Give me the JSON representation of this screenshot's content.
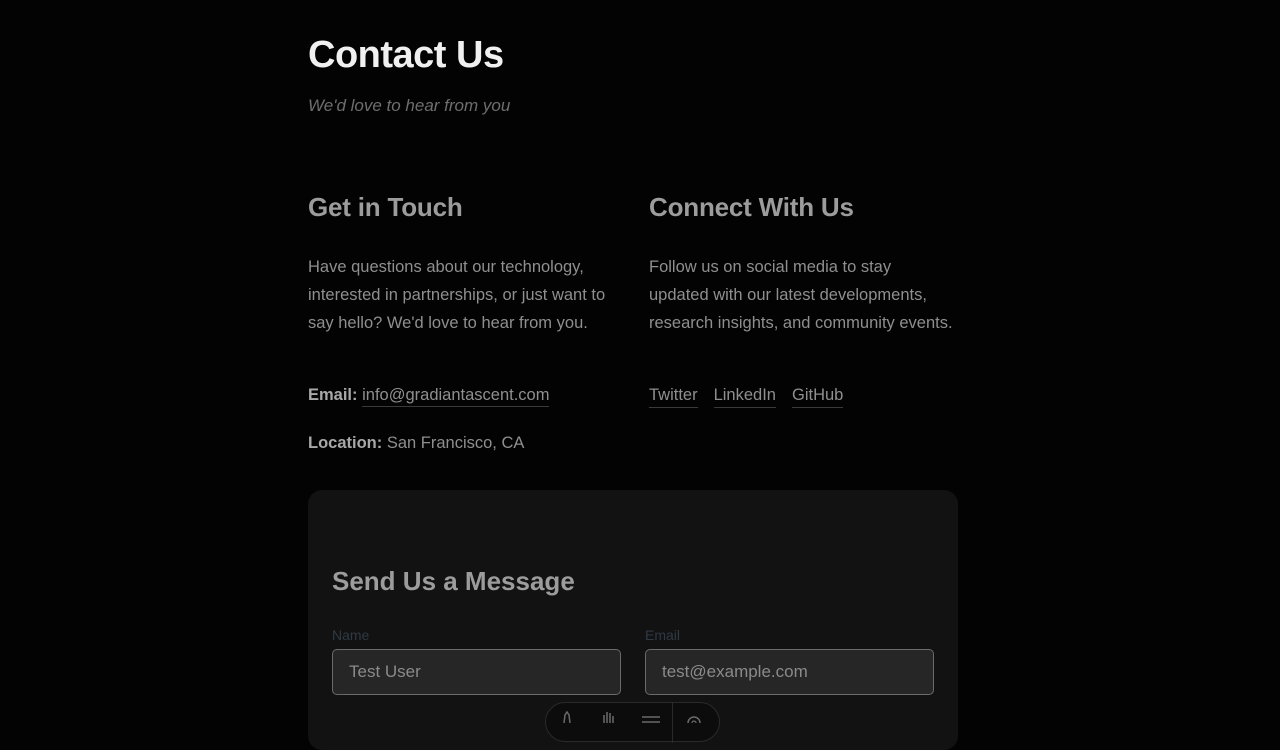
{
  "header": {
    "title": "Contact Us",
    "subtitle": "We'd love to hear from you"
  },
  "get_in_touch": {
    "heading": "Get in Touch",
    "body": "Have questions about our technology, interested in partnerships, or just want to say hello? We'd love to hear from you.",
    "email_label": "Email:",
    "email_value": "info@gradiantascent.com",
    "location_label": "Location:",
    "location_value": "San Francisco, CA"
  },
  "connect": {
    "heading": "Connect With Us",
    "body": "Follow us on social media to stay updated with our latest developments, research insights, and community events.",
    "links": [
      "Twitter",
      "LinkedIn",
      "GitHub"
    ]
  },
  "form": {
    "heading": "Send Us a Message",
    "name_label": "Name",
    "name_value": "Test User",
    "email_label": "Email",
    "email_value": "test@example.com"
  },
  "toolbar": {
    "icons": [
      "pen-icon",
      "hand-icon",
      "menu-icon",
      "gear-icon"
    ]
  }
}
